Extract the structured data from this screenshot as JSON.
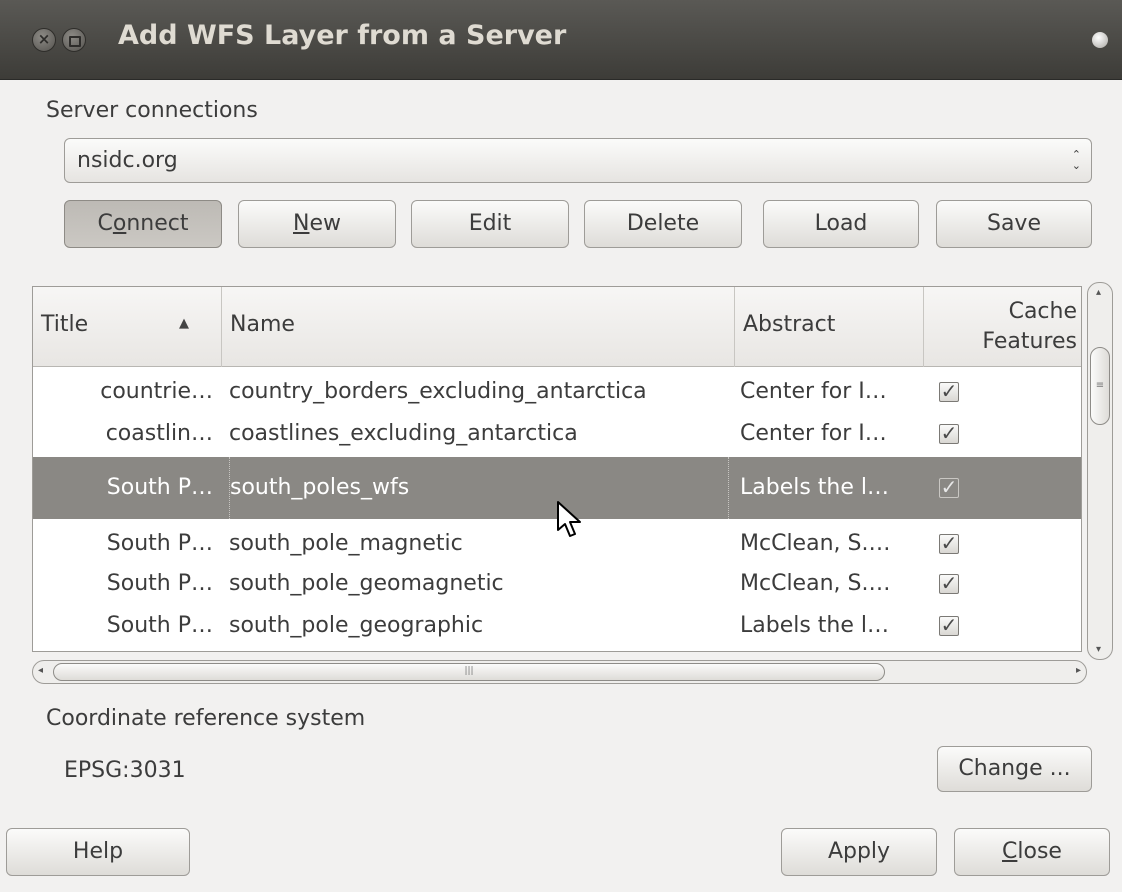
{
  "window": {
    "title": "Add WFS Layer from a Server"
  },
  "server": {
    "section_label": "Server connections",
    "selected": "nsidc.org"
  },
  "buttons": {
    "connect": {
      "pre": "C",
      "ul": "o",
      "post": "nnect"
    },
    "new": {
      "pre": "",
      "ul": "N",
      "post": "ew"
    },
    "edit": "Edit",
    "delete": "Delete",
    "load": "Load",
    "save": "Save",
    "change": "Change ...",
    "help": "Help",
    "apply": "Apply",
    "close": {
      "pre": "",
      "ul": "C",
      "post": "lose"
    }
  },
  "table": {
    "columns": {
      "title": "Title",
      "name": "Name",
      "abstract": "Abstract",
      "cache_line1": "Cache",
      "cache_line2": "Features"
    },
    "rows": [
      {
        "title": "countrie…",
        "name": "country_borders_excluding_antarctica",
        "abstract": "Center for I…",
        "cache": true
      },
      {
        "title": "coastlin…",
        "name": "coastlines_excluding_antarctica",
        "abstract": "Center for I…",
        "cache": true
      },
      {
        "title": "South P…",
        "name": "south_poles_wfs",
        "abstract": "Labels the l…",
        "cache": true,
        "selected": true
      },
      {
        "title": "South P…",
        "name": "south_pole_magnetic",
        "abstract": "McClean, S.…",
        "cache": true
      },
      {
        "title": "South P…",
        "name": "south_pole_geomagnetic",
        "abstract": "McClean, S.…",
        "cache": true
      },
      {
        "title": "South P…",
        "name": "south_pole_geographic",
        "abstract": "Labels the l…",
        "cache": true
      }
    ]
  },
  "crs": {
    "section_label": "Coordinate reference system",
    "value": "EPSG:3031"
  }
}
